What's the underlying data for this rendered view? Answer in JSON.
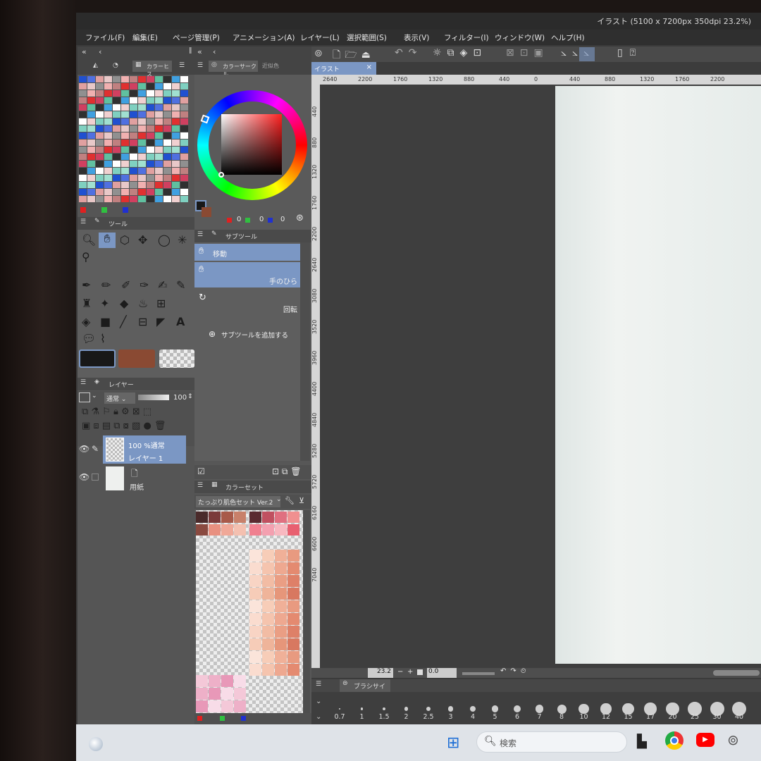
{
  "window": {
    "title": "イラスト (5100 x 7200px 350dpi 23.2%)"
  },
  "menu": [
    "ファイル(F)",
    "編集(E)",
    "ページ管理(P)",
    "アニメーション(A)",
    "レイヤー(L)",
    "選択範囲(S)",
    "表示(V)",
    "フィルター(I)",
    "ウィンドウ(W)",
    "ヘルプ(H)"
  ],
  "panels": {
    "color_history": {
      "label": "カラーヒス"
    },
    "color_circle": {
      "label": "カラーサークル",
      "tab2": "近似色",
      "values": [
        "0",
        "0",
        "0"
      ]
    },
    "tool": {
      "label": "ツール"
    },
    "subtool": {
      "label": "サブツール",
      "items": [
        "移動",
        "手のひら",
        "回転"
      ],
      "add_label": "サブツールを追加する"
    },
    "layer": {
      "label": "レイヤー",
      "blend_mode": "通常",
      "opacity": "100",
      "layers": [
        {
          "info": "100 %通常",
          "name": "レイヤー 1"
        },
        {
          "name": "用紙"
        }
      ]
    },
    "color_set": {
      "label": "カラーセット",
      "set_name": "たっぷり肌色セット  Ver.2"
    },
    "brush_size": {
      "label": "ブラシサイズ",
      "sizes": [
        "0.7",
        "1",
        "1.5",
        "2",
        "2.5",
        "3",
        "4",
        "5",
        "6",
        "7",
        "8",
        "10",
        "12",
        "15",
        "17",
        "20",
        "25",
        "30",
        "40"
      ]
    }
  },
  "canvas": {
    "tab": "イラスト",
    "tab_close": "×",
    "zoom": "23.2",
    "rotation": "0.0",
    "ruler_h": [
      "2640",
      "2200",
      "1760",
      "1320",
      "880",
      "440",
      "0",
      "440",
      "880",
      "1320",
      "1760",
      "2200"
    ],
    "ruler_v": [
      "440",
      "880",
      "1320",
      "1760",
      "2200",
      "2640",
      "3080",
      "3520",
      "3960",
      "4400",
      "4840",
      "5280",
      "5720",
      "6160",
      "6600",
      "7040"
    ]
  },
  "taskbar": {
    "search_placeholder": "検索"
  },
  "colors": {
    "main_color": "#181818",
    "sub_color": "#8a4a33",
    "selection_blue": "#7b97c4",
    "paper": "#e9eeec"
  }
}
